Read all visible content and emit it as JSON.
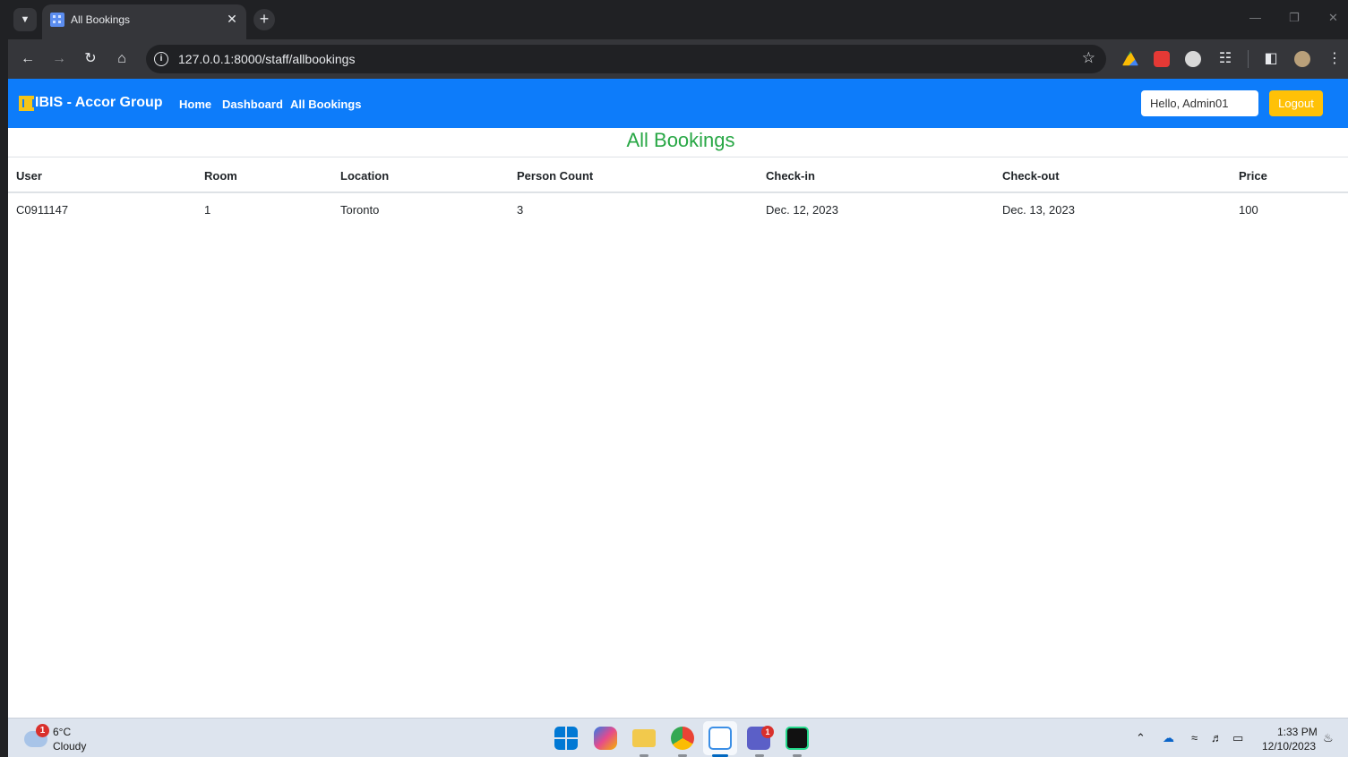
{
  "browser": {
    "tab_title": "All Bookings",
    "tab_close": "✕",
    "new_tab": "+",
    "url": "127.0.0.1:8000/staff/allbookings",
    "tab_search_icon": "chevron-down-icon",
    "star_icon": "star-icon"
  },
  "navbar": {
    "brand": "IBIS - Accor Group",
    "links": [
      "Home",
      "Dashboard",
      "All Bookings"
    ],
    "greeting": "Hello, Admin01",
    "logout": "Logout",
    "color": "#0d7cfa",
    "logout_color": "#ffc107"
  },
  "main": {
    "heading": "All Bookings",
    "heading_color": "#28a745",
    "table": {
      "headers": [
        "User",
        "Room",
        "Location",
        "Person Count",
        "Check-in",
        "Check-out",
        "Price"
      ],
      "rows": [
        [
          "C0911147",
          "1",
          "Toronto",
          "3",
          "Dec. 12, 2023",
          "Dec. 13, 2023",
          "100"
        ]
      ]
    }
  },
  "taskbar": {
    "weather_temp": "6°C",
    "weather_desc": "Cloudy",
    "weather_badge": "1",
    "teams_badge": "1",
    "time": "1:33 PM",
    "date": "12/10/2023"
  }
}
